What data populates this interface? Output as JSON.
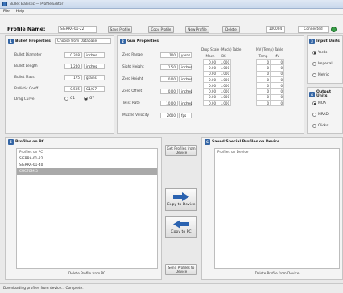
{
  "window": {
    "title": "Bullet Ballistic — Profile Editor"
  },
  "menu": [
    "File",
    "Help"
  ],
  "toolbar": {
    "profile_label": "Profile Name:",
    "profile_value": "SIERRA-01-22",
    "buttons": [
      "Save Profile",
      "Copy Profile",
      "New Profile",
      "Delete"
    ],
    "status_box_1": "100004",
    "status_box_2": "Connected"
  },
  "bullet_panel": {
    "num": "1",
    "title": "Bullet Properties",
    "dropdown": "Choose from Database",
    "rows": [
      {
        "label": "Bullet Diameter",
        "value": "0.308",
        "unit": "inches"
      },
      {
        "label": "Bullet Length",
        "value": "1.240",
        "unit": "inches"
      },
      {
        "label": "Bullet Mass",
        "value": "175",
        "unit": "grains"
      },
      {
        "label": "Ballistic Coeff.",
        "value": "0.505",
        "unit": "G1/G7"
      }
    ],
    "drag_label": "Drag Curve",
    "drag_options": [
      "G1",
      "G7"
    ],
    "drag_selected": 1
  },
  "gun_panel": {
    "num": "2",
    "title": "Gun Properties",
    "rows": [
      {
        "label": "Zero Range",
        "value": "100",
        "unit": "yards"
      },
      {
        "label": "Sight Height",
        "value": "1.50",
        "unit": "inches"
      },
      {
        "label": "Zero Height",
        "value": "0.00",
        "unit": "inches"
      },
      {
        "label": "Zero Offset",
        "value": "0.00",
        "unit": "inches"
      },
      {
        "label": "Twist Rate",
        "value": "10.00",
        "unit": "inches"
      },
      {
        "label": "Muzzle Velocity",
        "value": "2600",
        "unit": "fps"
      }
    ],
    "mach_title": "Drop Scale (Mach) Table",
    "mach_cols": [
      "Mach",
      "BC"
    ],
    "mach_rows": [
      [
        "0.00",
        "1.000"
      ],
      [
        "0.00",
        "1.000"
      ],
      [
        "0.00",
        "1.000"
      ],
      [
        "0.00",
        "1.000"
      ],
      [
        "0.00",
        "1.000"
      ],
      [
        "0.00",
        "1.000"
      ],
      [
        "0.00",
        "1.000"
      ],
      [
        "0.00",
        "1.000"
      ]
    ],
    "mv_title": "MV (Temp) Table",
    "mv_cols": [
      "Temp",
      "MV"
    ],
    "mv_rows": [
      [
        "0",
        "0"
      ],
      [
        "0",
        "0"
      ],
      [
        "0",
        "0"
      ],
      [
        "0",
        "0"
      ],
      [
        "0",
        "0"
      ],
      [
        "0",
        "0"
      ],
      [
        "0",
        "0"
      ],
      [
        "0",
        "0"
      ]
    ]
  },
  "units_panel": {
    "num": "3",
    "title": "Input Units",
    "options": [
      "Yards",
      "Imperial",
      "Metric"
    ],
    "selected": 0
  },
  "output_panel": {
    "num": "4",
    "title": "Output Units",
    "options": [
      "MOA",
      "MRAD",
      "Clicks"
    ],
    "selected": 0
  },
  "profiles_panel": {
    "num": "5",
    "title": "Profiles on PC",
    "header": "Profiles on PC",
    "items": [
      "SIERRA-01-22",
      "SIERRA-01-40",
      "CUSTOM-3"
    ],
    "selected": 2,
    "footer": "Delete Profile from PC"
  },
  "transfer": {
    "get_btn": "Get Profiles from Device",
    "copy_to_device": "Copy to Device",
    "copy_to_pc": "Copy to PC",
    "send_btn": "Send Profiles to Device"
  },
  "device_panel": {
    "num": "6",
    "title": "Saved Special Profiles on Device",
    "header": "Profiles on Device",
    "footer": "Delete Profile from Device"
  },
  "statusbar": {
    "text": "Downloading profiles from device... Complete."
  },
  "colors": {
    "accent": "#3465a4",
    "arrow": "#2a62b0"
  }
}
